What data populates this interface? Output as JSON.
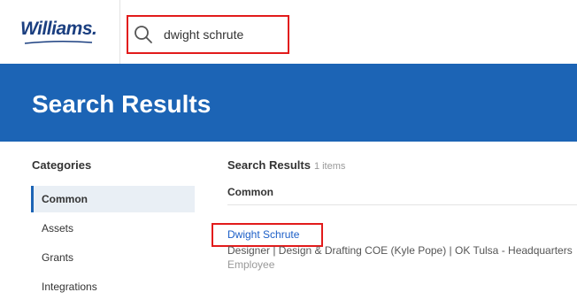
{
  "header": {
    "logo_text": "Williams.",
    "search": {
      "value": "dwight schrute",
      "icon": "search-icon"
    }
  },
  "banner": {
    "title": "Search Results"
  },
  "sidebar": {
    "heading": "Categories",
    "items": [
      {
        "label": "Common",
        "active": true
      },
      {
        "label": "Assets",
        "active": false
      },
      {
        "label": "Grants",
        "active": false
      },
      {
        "label": "Integrations",
        "active": false
      }
    ]
  },
  "results": {
    "heading": "Search Results",
    "count": "1 items",
    "section": "Common",
    "items": [
      {
        "name": "Dwight Schrute",
        "detail": "Designer | Design & Drafting COE (Kyle Pope) | OK Tulsa - Headquarters",
        "type": "Employee"
      }
    ]
  },
  "colors": {
    "brand_blue": "#1c64b5",
    "logo_blue": "#1b3f80",
    "highlight_red": "#e21b1b",
    "link_blue": "#1b5ec7"
  }
}
